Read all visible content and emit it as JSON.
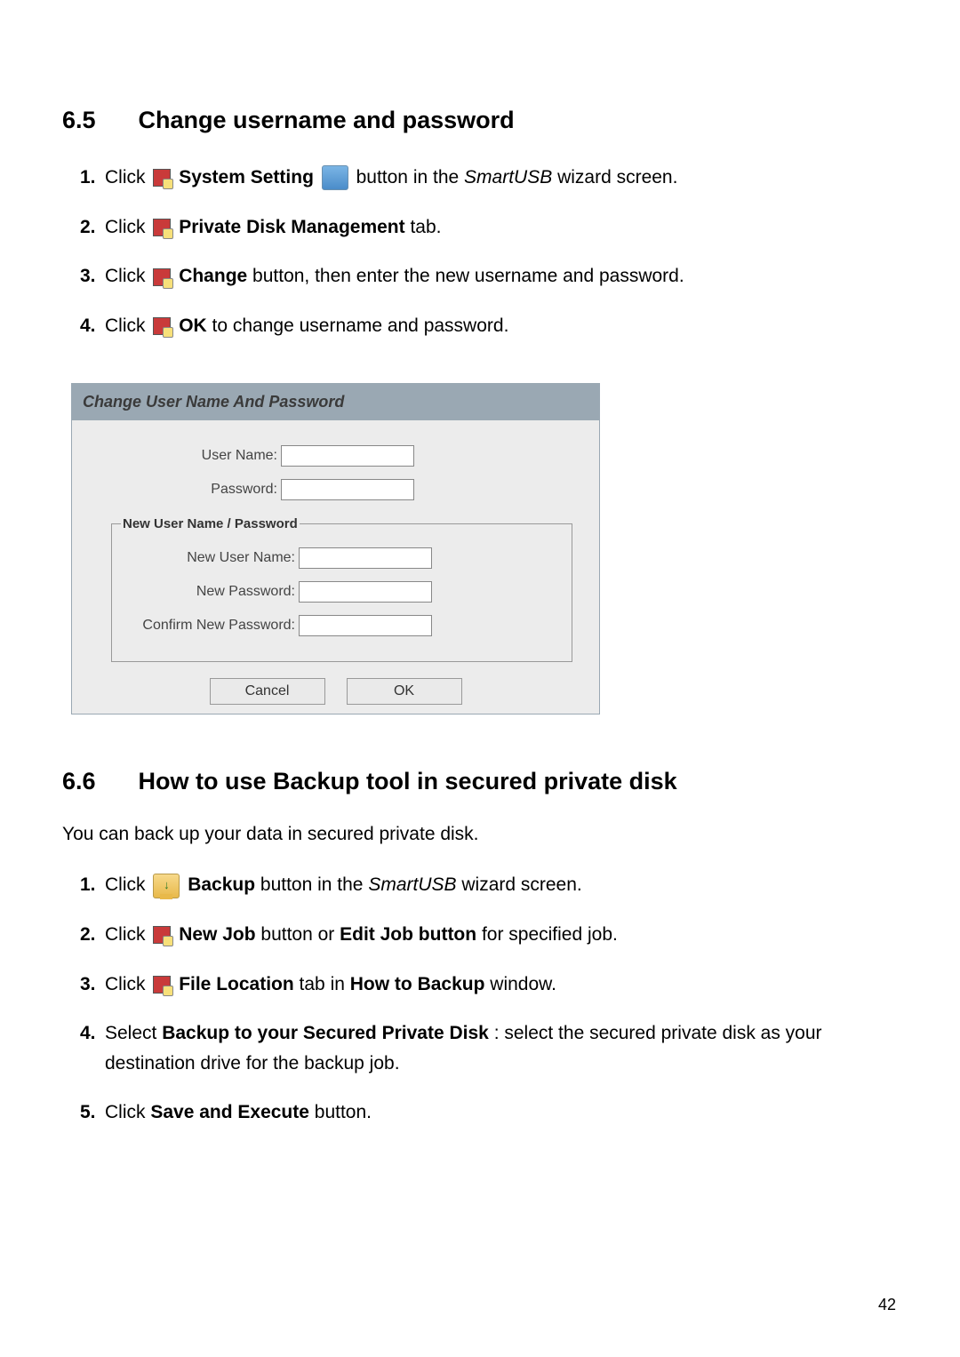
{
  "page_number": "42",
  "section65": {
    "number": "6.5",
    "title": "Change username and password",
    "steps": [
      {
        "num": "1.",
        "pre": "Click ",
        "bold": "System Setting",
        "post_icon": "big",
        "post": " button in the ",
        "italic": "SmartUSB",
        "tail": " wizard screen."
      },
      {
        "num": "2.",
        "pre": "Click ",
        "bold": "Private Disk Management",
        "tail": " tab."
      },
      {
        "num": "3.",
        "pre": "Click ",
        "bold": "Change",
        "tail": " button, then enter the new username and password."
      },
      {
        "num": "4.",
        "pre": "Click ",
        "bold": "OK",
        "tail": " to change username and password."
      }
    ]
  },
  "dialog": {
    "title": "Change User Name And Password",
    "user_name_label": "User Name:",
    "password_label": "Password:",
    "fieldset_legend": "New User Name / Password",
    "new_user_name_label": "New User Name:",
    "new_password_label": "New Password:",
    "confirm_new_password_label": "Confirm New Password:",
    "cancel": "Cancel",
    "ok": "OK"
  },
  "section66": {
    "number": "6.6",
    "title": "How to use Backup tool in secured private disk",
    "intro": "You can back up your data in secured private disk.",
    "steps": [
      {
        "num": "1.",
        "pre": "Click ",
        "icon": "backup",
        "bold": "Backup",
        "post": " button in the ",
        "italic": "SmartUSB",
        "tail": " wizard screen."
      },
      {
        "num": "2.",
        "pre": "Click ",
        "bold": "New Job",
        "mid": " button or ",
        "bold2": "Edit Job button",
        "tail": " for specified job."
      },
      {
        "num": "3.",
        "pre": "Click ",
        "bold": "File Location",
        "mid": " tab in ",
        "bold2": "How to Backup",
        "tail": " window."
      },
      {
        "num": "4.",
        "pre": "Select ",
        "bold": "Backup to your Secured Private Disk",
        "tail": ": select the secured private disk as your destination drive for the backup job."
      },
      {
        "num": "5.",
        "pre": "Click ",
        "bold": "Save and Execute",
        "tail": " button."
      }
    ]
  }
}
